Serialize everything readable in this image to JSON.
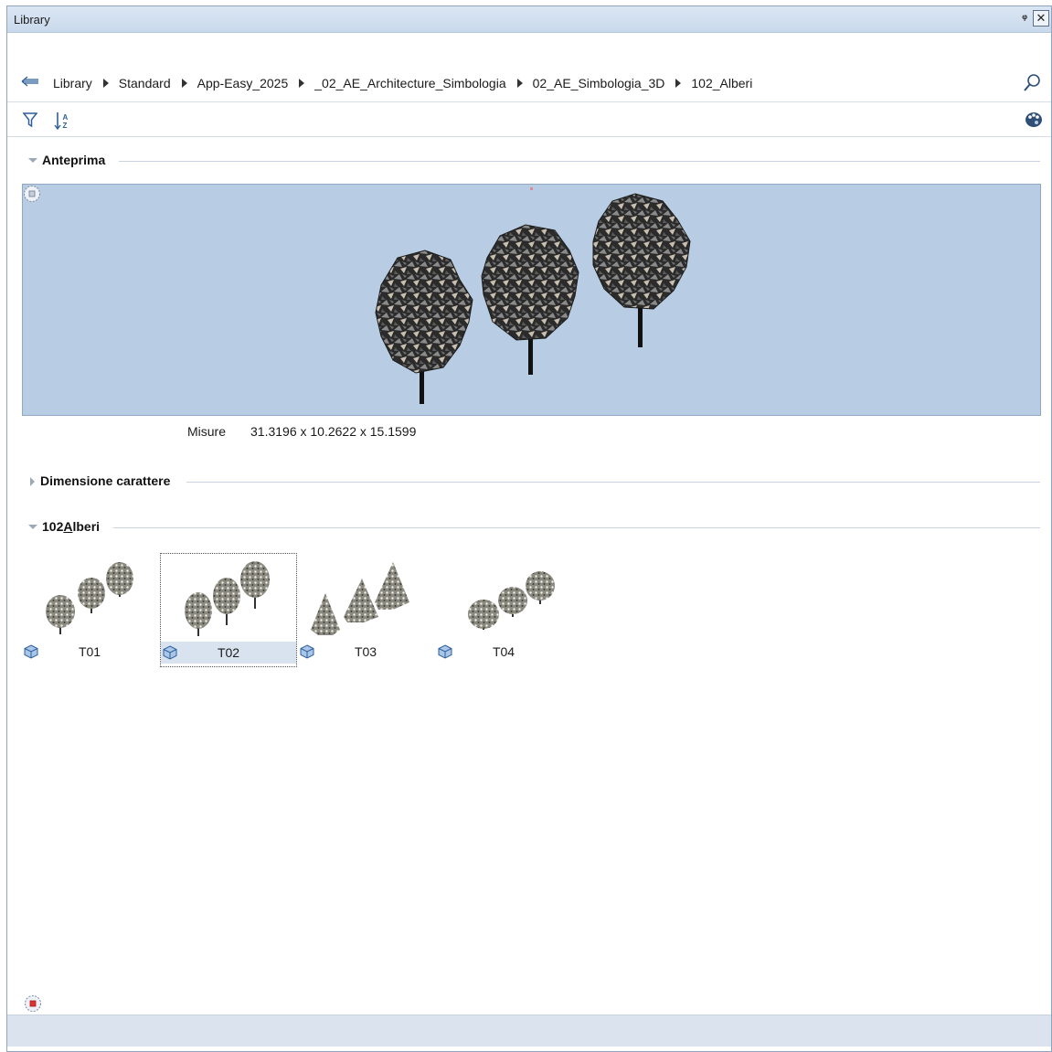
{
  "window": {
    "title": "Library",
    "pin": "ᵠ",
    "close": "✕"
  },
  "breadcrumb": {
    "items": [
      "Library",
      "Standard",
      "App-Easy_2025",
      "_02_AE_Architecture_Simbologia",
      "02_AE_Simbologia_3D",
      "102_Alberi"
    ]
  },
  "sections": {
    "preview": {
      "label": "Anteprima",
      "expanded": true
    },
    "font_size": {
      "label": "Dimensione carattere",
      "expanded": false
    },
    "folder": {
      "label_prefix": "102",
      "label_underlined": "A",
      "label_suffix": "lberi",
      "expanded": true
    }
  },
  "preview": {
    "measures_label": "Misure",
    "measures_value": "31.3196 x 10.2622 x 15.1599",
    "background": "#b8cde4"
  },
  "items": [
    {
      "name": "T01",
      "shape": "round-trees",
      "selected": false
    },
    {
      "name": "T02",
      "shape": "round-trees-tall",
      "selected": true
    },
    {
      "name": "T03",
      "shape": "cone-trees",
      "selected": false
    },
    {
      "name": "T04",
      "shape": "round-trees-wide",
      "selected": false
    }
  ],
  "icons": {
    "back": "back-arrow-icon",
    "search": "search-icon",
    "filter": "filter-icon",
    "sort": "sort-az-icon",
    "palette": "palette-icon",
    "navigation": "navigation-cube-icon",
    "item_type": "3d-object-icon"
  }
}
